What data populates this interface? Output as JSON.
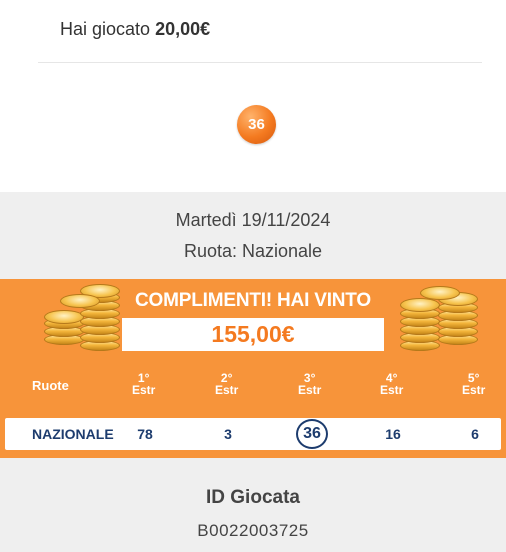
{
  "played": {
    "prefix": "Hai giocato",
    "amount": "20,00€"
  },
  "played_number": "36",
  "draw": {
    "date": "Martedì 19/11/2024",
    "ruota": "Ruota: Nazionale"
  },
  "win": {
    "title": "COMPLIMENTI! HAI VINTO",
    "amount": "155,00€"
  },
  "table": {
    "ruote_label": "Ruote",
    "headers": [
      {
        "n": "1°",
        "s": "Estr"
      },
      {
        "n": "2°",
        "s": "Estr"
      },
      {
        "n": "3°",
        "s": "Estr"
      },
      {
        "n": "4°",
        "s": "Estr"
      },
      {
        "n": "5°",
        "s": "Estr"
      }
    ],
    "row": {
      "name": "NAZIONALE",
      "values": [
        "78",
        "3",
        "36",
        "16",
        "6"
      ],
      "matched_index": 2
    }
  },
  "id": {
    "label": "ID Giocata",
    "value": "B0022003725"
  },
  "colors": {
    "accent": "#f7943a",
    "number": "#1d3c6e"
  },
  "icons": [
    "coin-stack-icon",
    "coin-stack-icon"
  ]
}
